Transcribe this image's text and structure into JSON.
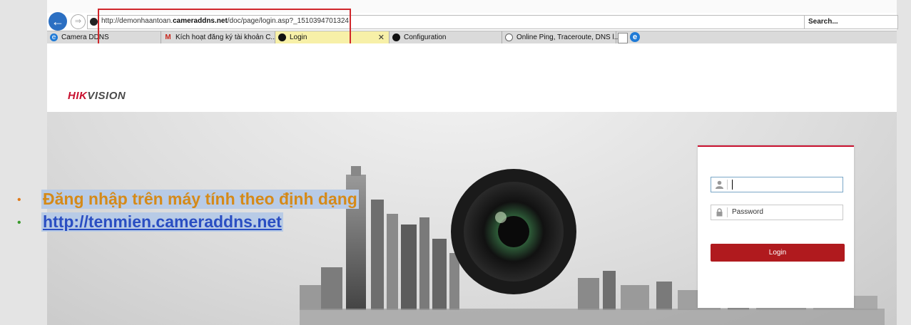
{
  "browser": {
    "url_prefix": "http://demonhaantoan.",
    "url_bold": "cameraddns.net",
    "url_suffix": "/doc/page/login.asp?_1510394701324",
    "search_placeholder": "Search...",
    "tabs": [
      {
        "label": "Camera DDNS",
        "icon": "ie-icon"
      },
      {
        "label": "Kích hoạt đăng ký tài khoản C...",
        "icon": "gmail-icon"
      },
      {
        "label": "Login",
        "icon": "hikvision-favicon",
        "active": true
      },
      {
        "label": "Configuration",
        "icon": "hikvision-favicon"
      },
      {
        "label": "Online Ping, Traceroute, DNS l...",
        "icon": "site-favicon"
      }
    ]
  },
  "page": {
    "logo_hik": "HIK",
    "logo_vision": "VISION",
    "password_placeholder": "Password",
    "login_label": "Login"
  },
  "slide": {
    "bullet1": "Đăng nhập trên máy tính theo định dạng",
    "bullet2": "http://tenmien.cameraddns.net",
    "bullet_dot": "•"
  },
  "colors": {
    "accent_red": "#c8102e",
    "highlight": "#b8cbe6"
  }
}
